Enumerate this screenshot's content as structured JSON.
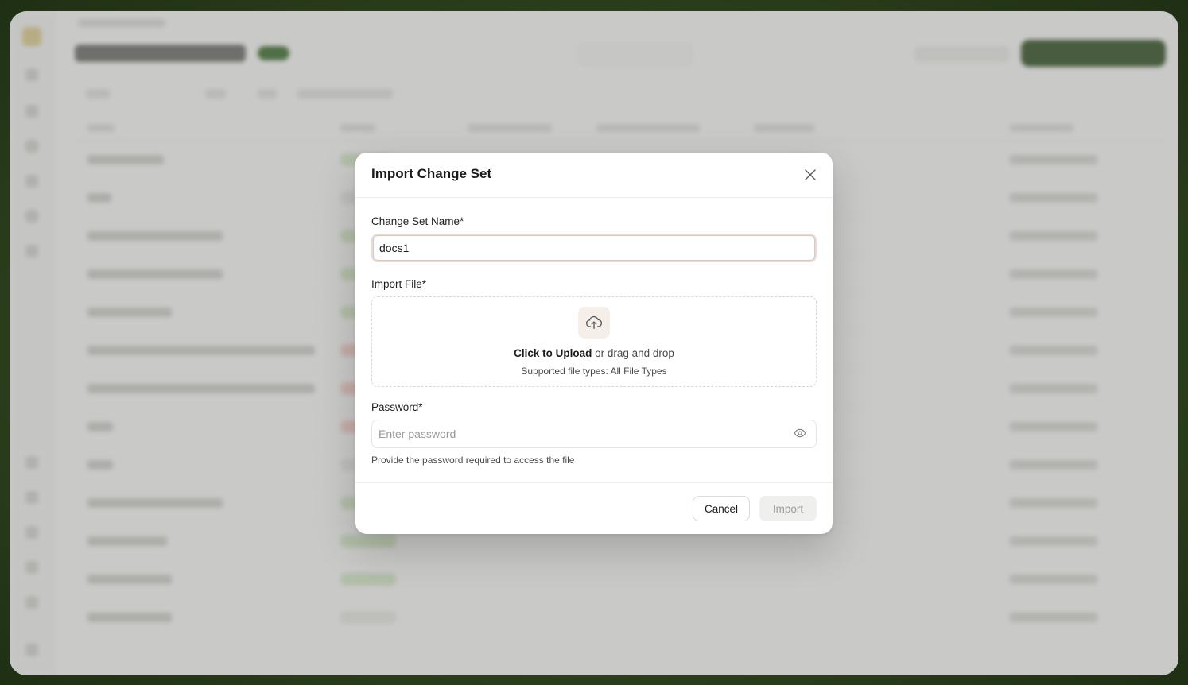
{
  "modal": {
    "title": "Import Change Set",
    "name_label": "Change Set Name*",
    "name_value": "docs1",
    "file_label": "Import File*",
    "upload_strong": "Click to Upload",
    "upload_rest": " or drag and drop",
    "upload_hint": "Supported file types: All File Types",
    "password_label": "Password*",
    "password_placeholder": "Enter password",
    "password_help": "Provide the password required to access the file",
    "cancel_label": "Cancel",
    "import_label": "Import"
  },
  "icons": {
    "close": "close-icon",
    "upload": "cloud-upload-icon",
    "eye": "eye-icon"
  },
  "colors": {
    "accent_bg": "#2f4d22",
    "input_focus_border": "#e7ddd6",
    "upload_icon_bg": "#f6eee9"
  }
}
